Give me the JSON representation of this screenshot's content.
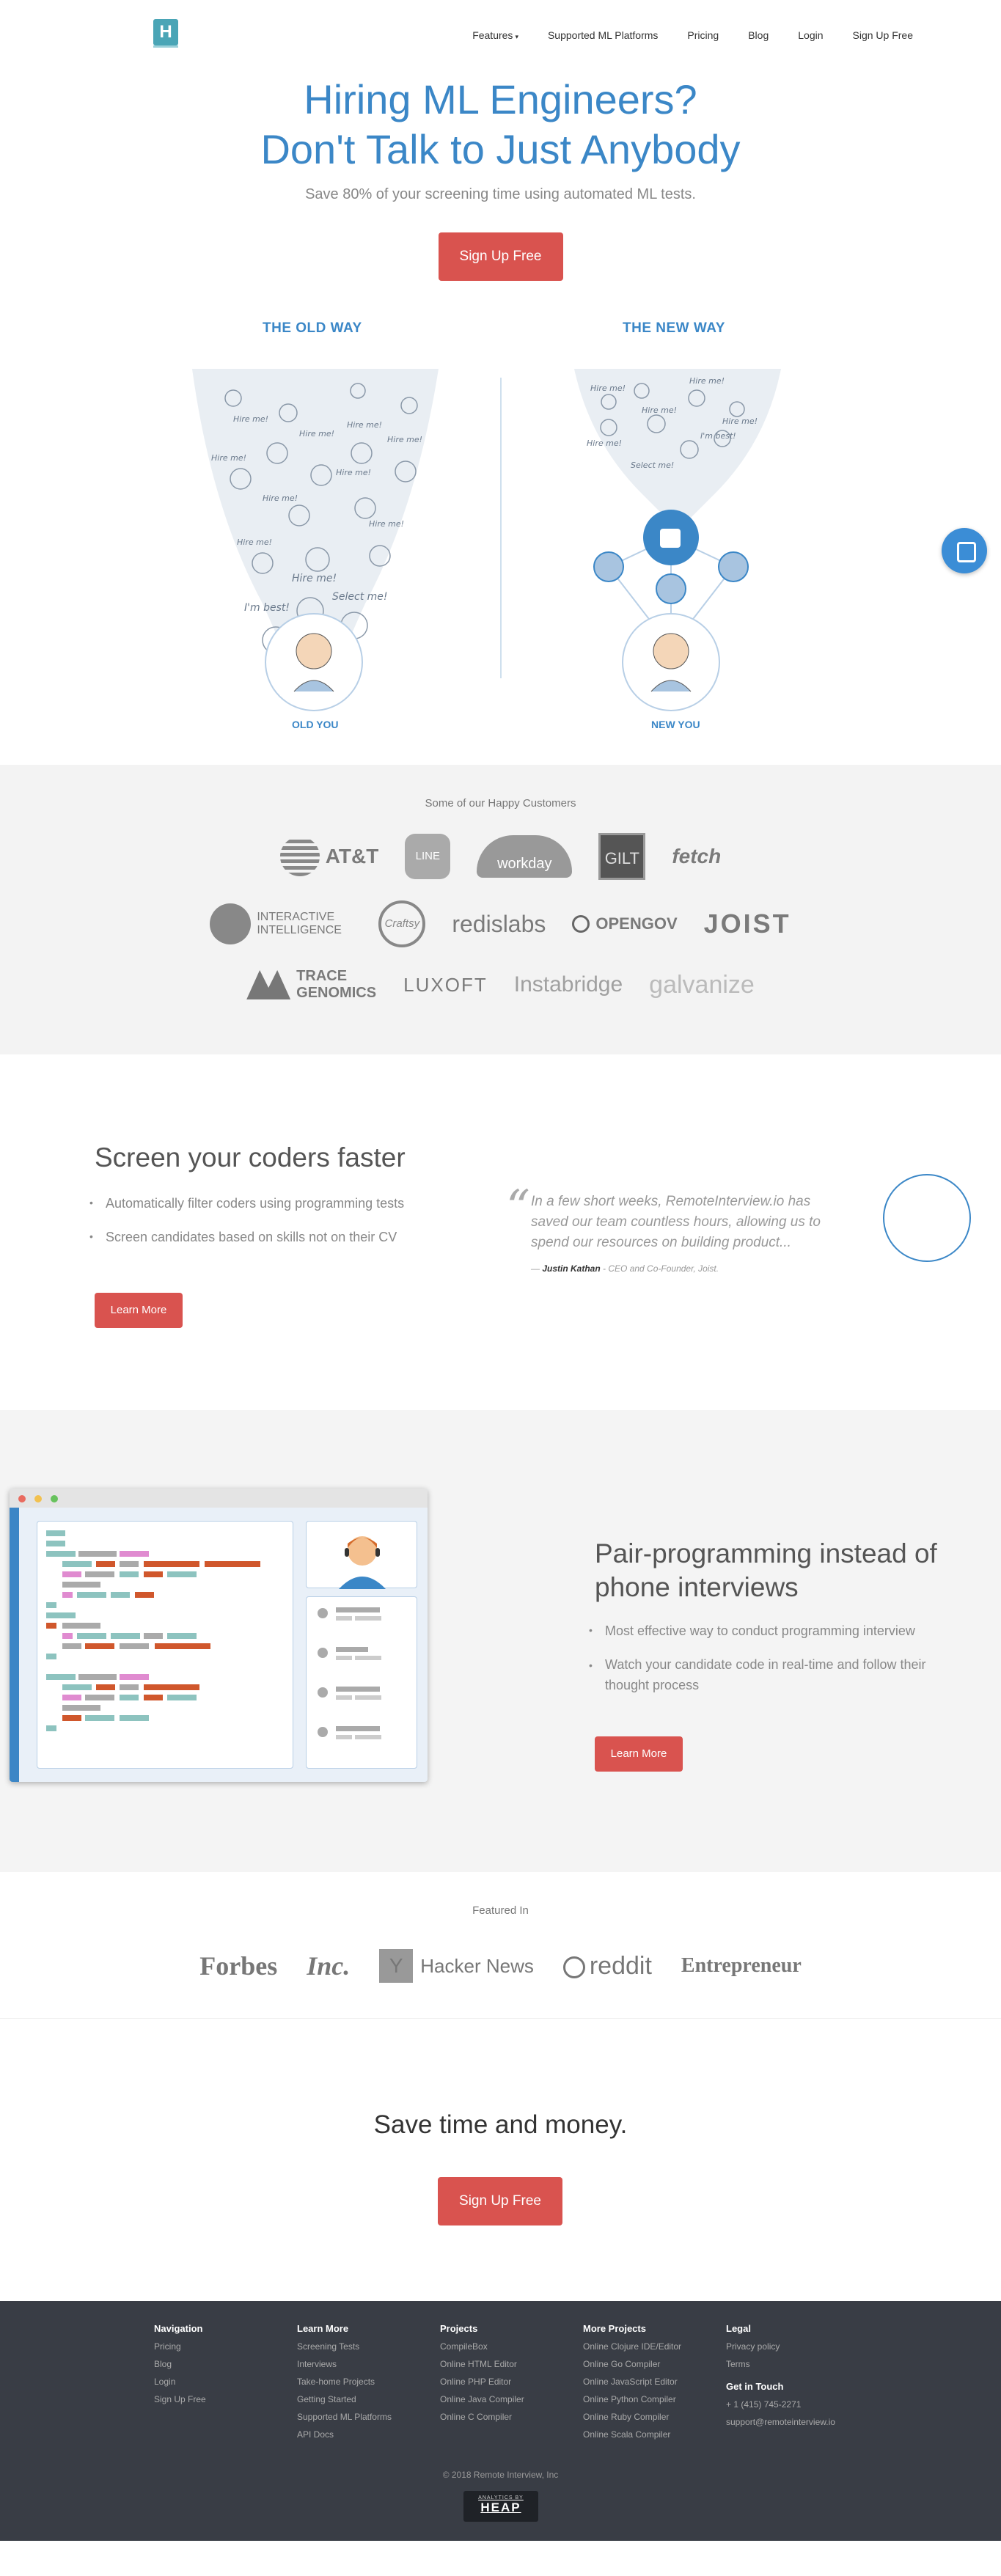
{
  "nav": {
    "items": [
      {
        "label": "Features",
        "caret": "▾"
      },
      {
        "label": "Supported ML Platforms"
      },
      {
        "label": "Pricing"
      },
      {
        "label": "Blog"
      },
      {
        "label": "Login"
      },
      {
        "label": "Sign Up Free"
      }
    ]
  },
  "hero": {
    "line1": "Hiring ML Engineers?",
    "line2": "Don't Talk to Just Anybody",
    "subtitle": "Save 80% of your screening time using automated ML tests.",
    "cta": "Sign Up Free"
  },
  "ways": {
    "old_title": "THE OLD WAY",
    "new_title": "THE NEW WAY",
    "old_label": "OLD YOU",
    "new_label": "NEW YOU",
    "bubbles": [
      "Hire me!",
      "I'm best!",
      "Select me!"
    ]
  },
  "customers": {
    "heading": "Some of our Happy Customers",
    "row1": [
      "AT&T",
      "LINE",
      "workday",
      "GILT",
      "fetch"
    ],
    "row2": [
      "INTERACTIVE INTELLIGENCE",
      "Craftsy",
      "redislabs",
      "OPENGOV",
      "JOIST"
    ],
    "row3": [
      "TRACE GENOMICS",
      "LUXOFT",
      "Instabridge",
      "galvanize"
    ]
  },
  "screen": {
    "title": "Screen your coders faster",
    "bullets": [
      "Automatically filter coders using programming tests",
      "Screen candidates based on skills not on their CV"
    ],
    "button": "Learn More",
    "quote": "In a few short weeks, RemoteInterview.io has saved our team countless hours, allowing us to spend our resources on building product...",
    "author": "Justin Kathan",
    "author_role": "- CEO and Co-Founder, Joist."
  },
  "pair": {
    "title": "Pair-programming instead of phone interviews",
    "bullets": [
      "Most effective way to conduct programming interview",
      "Watch your candidate code in real-time and follow their thought process"
    ],
    "button": "Learn More"
  },
  "featured": {
    "heading": "Featured In",
    "logos": [
      "Forbes",
      "Inc.",
      "Hacker News",
      "reddit",
      "Entrepreneur"
    ]
  },
  "cta": {
    "title": "Save time and money.",
    "button": "Sign Up Free"
  },
  "footer": {
    "columns": [
      {
        "title": "Navigation",
        "links": [
          "Pricing",
          "Blog",
          "Login",
          "Sign Up Free"
        ]
      },
      {
        "title": "Learn More",
        "links": [
          "Screening Tests",
          "Interviews",
          "Take-home Projects",
          "Getting Started",
          "Supported ML Platforms",
          "API Docs"
        ]
      },
      {
        "title": "Projects",
        "links": [
          "CompileBox",
          "Online HTML Editor",
          "Online PHP Editor",
          "Online Java Compiler",
          "Online C Compiler"
        ]
      },
      {
        "title": "More Projects",
        "links": [
          "Online Clojure IDE/Editor",
          "Online Go Compiler",
          "Online JavaScript Editor",
          "Online Python Compiler",
          "Online Ruby Compiler",
          "Online Scala Compiler"
        ]
      },
      {
        "title": "Legal",
        "links": [
          "Privacy policy",
          "Terms"
        ]
      }
    ],
    "touch_title": "Get in Touch",
    "phone": "+ 1 (415) 745-2271",
    "email": "support@remoteinterview.io",
    "copyright": "© 2018 Remote Interview, Inc",
    "heap_small": "ANALYTICS BY",
    "heap": "HEAP"
  },
  "colors": {
    "brand": "#3b87c7",
    "cta": "#d9534f",
    "footer": "#393d45"
  }
}
